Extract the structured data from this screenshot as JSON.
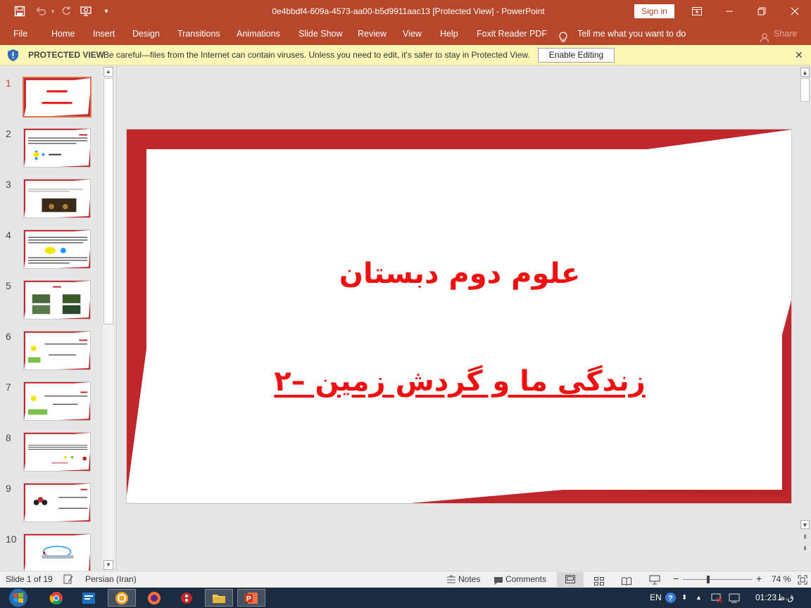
{
  "window": {
    "title": "0e4bbdf4-609a-4573-aa00-b5d9911aac13 [Protected View]  -  PowerPoint",
    "sign_in": "Sign in"
  },
  "ribbon": {
    "tabs": [
      "File",
      "Home",
      "Insert",
      "Design",
      "Transitions",
      "Animations",
      "Slide Show",
      "Review",
      "View",
      "Help",
      "Foxit Reader PDF"
    ],
    "tell_me": "Tell me what you want to do",
    "share": "Share"
  },
  "protected_view": {
    "label": "PROTECTED VIEW",
    "message": "Be careful—files from the Internet can contain viruses. Unless you need to edit, it's safer to stay in Protected View.",
    "enable_button": "Enable Editing"
  },
  "thumbnails": {
    "numbers": [
      "1",
      "2",
      "3",
      "4",
      "5",
      "6",
      "7",
      "8",
      "9",
      "10"
    ],
    "active_index": 0
  },
  "slide": {
    "title": "علوم دوم دبستان",
    "subtitle": "زندگی ما و گردش زمین –۲",
    "text_color": "#ee1111",
    "frame_color": "#c0272d"
  },
  "status": {
    "slide_info": "Slide 1 of 19",
    "language": "Persian (Iran)",
    "notes": "Notes",
    "comments": "Comments",
    "zoom": "74 %",
    "zoom_percent": 74
  },
  "taskbar": {
    "lang": "EN",
    "time": "01:23",
    "period": "ق.ظ"
  },
  "colors": {
    "accent": "#b7472a",
    "warning_bar": "#fcf7b6"
  }
}
